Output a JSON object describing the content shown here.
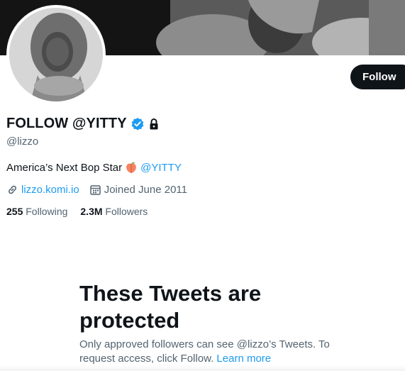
{
  "profile": {
    "display_name": "FOLLOW @YITTY",
    "handle": "@lizzo",
    "bio_text": "America’s Next Bop Star",
    "bio_mention": "@YITTY",
    "website": "lizzo.komi.io",
    "joined": "Joined June 2011",
    "following_count": "255",
    "following_label": "Following",
    "followers_count": "2.3M",
    "followers_label": "Followers"
  },
  "actions": {
    "follow_label": "Follow"
  },
  "protected": {
    "title": "These Tweets are protected",
    "description": "Only approved followers can see @lizzo’s Tweets. To request access, click Follow.",
    "learn_more": "Learn more"
  },
  "icons": {
    "verified": "verified-badge-icon",
    "lock": "lock-icon",
    "peach": "peach-emoji-icon",
    "link": "link-icon",
    "calendar": "calendar-icon"
  },
  "colors": {
    "accent": "#1d9bf0",
    "text": "#0f1419",
    "secondary": "#536471",
    "button_bg": "#0f1419"
  }
}
